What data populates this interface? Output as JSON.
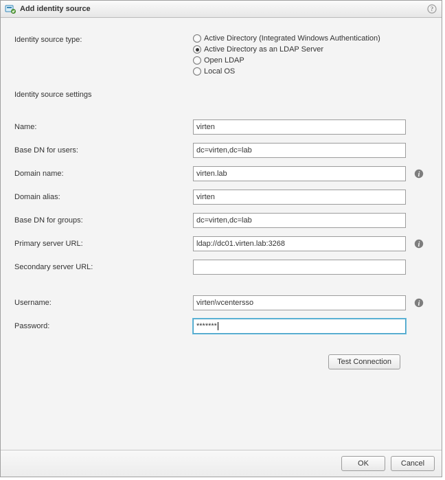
{
  "dialog": {
    "title": "Add identity source"
  },
  "labels": {
    "identity_source_type": "Identity source type:",
    "identity_source_settings": "Identity source settings",
    "name": "Name:",
    "base_dn_users": "Base DN for users:",
    "domain_name": "Domain name:",
    "domain_alias": "Domain alias:",
    "base_dn_groups": "Base DN for groups:",
    "primary_server_url": "Primary server URL:",
    "secondary_server_url": "Secondary server URL:",
    "username": "Username:",
    "password": "Password:"
  },
  "radios": {
    "options": [
      "Active Directory (Integrated Windows Authentication)",
      "Active Directory as an LDAP Server",
      "Open LDAP",
      "Local OS"
    ],
    "selected_index": 1
  },
  "fields": {
    "name": "virten",
    "base_dn_users": "dc=virten,dc=lab",
    "domain_name": "virten.lab",
    "domain_alias": "virten",
    "base_dn_groups": "dc=virten,dc=lab",
    "primary_server_url": "ldap://dc01.virten.lab:3268",
    "secondary_server_url": "",
    "username": "virten\\vcentersso",
    "password": "*******"
  },
  "buttons": {
    "test_connection": "Test Connection",
    "ok": "OK",
    "cancel": "Cancel"
  }
}
